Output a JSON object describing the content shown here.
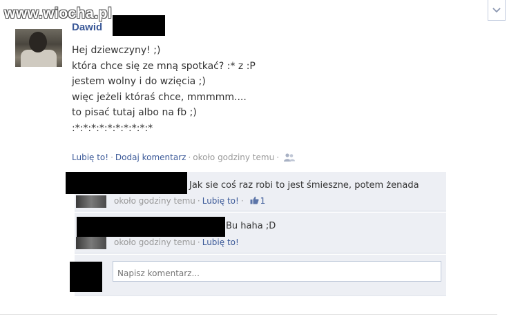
{
  "watermark": "www.wiocha.pl",
  "post": {
    "author": "Dawid",
    "lines": [
      "Hej dziewczyny! ;)",
      "która chce się ze mną spotkać? :* z :P",
      "jestem wolny i do wzięcia ;)",
      "więc jeżeli któraś chce, mmmmm....",
      "to pisać tutaj albo na fb ;)",
      ":*:*:*:*:*:*:*:*:*:*"
    ],
    "actions": {
      "like": "Lubię to!",
      "comment": "Dodaj komentarz",
      "time": "około godziny temu",
      "audience_icon": "people-icon"
    }
  },
  "comments": [
    {
      "text": "Jak sie coś raz robi to jest śmieszne, potem żenada",
      "time": "około godziny temu",
      "like": "Lubię to!",
      "like_count": "1"
    },
    {
      "text": "Bu haha ;D",
      "time": "około godziny temu",
      "like": "Lubię to!"
    }
  ],
  "composer": {
    "placeholder": "Napisz komentarz..."
  },
  "colors": {
    "link": "#3b5998",
    "comment_bg": "#edeff4",
    "meta": "#999999"
  },
  "icons": {
    "dropdown": "chevron-down-icon",
    "like": "thumbs-up-icon"
  }
}
